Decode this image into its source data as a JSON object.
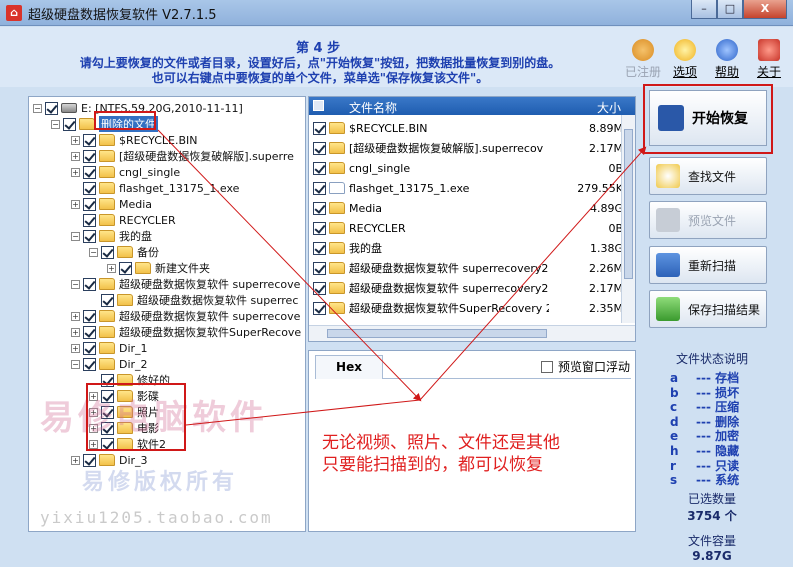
{
  "window": {
    "title": "超级硬盘数据恢复软件 V2.7.1.5",
    "buttons": {
      "minimize": "–",
      "maximize": "□",
      "close": "X"
    }
  },
  "header": {
    "step": "第 4 步",
    "line1": "请勾上要恢复的文件或者目录，设置好后，点\"开始恢复\"按钮，把数据批量恢复到别的盘。",
    "line2": "也可以右键点中要恢复的单个文件，菜单选\"保存恢复该文件\"。"
  },
  "topicons": [
    {
      "label": "已注册",
      "icon": "cart-icon",
      "disabled": true
    },
    {
      "label": "选项",
      "icon": "gear-icon",
      "disabled": false
    },
    {
      "label": "帮助",
      "icon": "help-icon",
      "disabled": false
    },
    {
      "label": "关于",
      "icon": "home-icon",
      "disabled": false
    }
  ],
  "tree": {
    "root": "E:  [NTFS,59.20G,2010-11-11]",
    "items": [
      {
        "label": "删除的文件",
        "selected": true
      },
      {
        "label": "$RECYCLE.BIN"
      },
      {
        "label": "[超级硬盘数据恢复破解版].superre"
      },
      {
        "label": "cngl_single"
      },
      {
        "label": "flashget_13175_1.exe"
      },
      {
        "label": "Media"
      },
      {
        "label": "RECYCLER"
      },
      {
        "label": "我的盘"
      },
      {
        "label": "备份"
      },
      {
        "label": "新建文件夹"
      },
      {
        "label": "超级硬盘数据恢复软件 superrecove"
      },
      {
        "label": "超级硬盘数据恢复软件 superrec"
      },
      {
        "label": "超级硬盘数据恢复软件 superrecove"
      },
      {
        "label": "超级硬盘数据恢复软件SuperRecove"
      },
      {
        "label": "Dir_1"
      },
      {
        "label": "Dir_2"
      },
      {
        "label": "修好的"
      },
      {
        "label": "影碟"
      },
      {
        "label": "照片"
      },
      {
        "label": "电影"
      },
      {
        "label": "软件2"
      },
      {
        "label": "Dir_3"
      }
    ]
  },
  "filelist": {
    "col_name": "文件名称",
    "col_size": "大小",
    "rows": [
      {
        "name": "$RECYCLE.BIN",
        "size": "8.89M"
      },
      {
        "name": "[超级硬盘数据恢复破解版].superrecov",
        "size": "2.17M"
      },
      {
        "name": "cngl_single",
        "size": "0B"
      },
      {
        "name": "flashget_13175_1.exe",
        "size": "279.55K"
      },
      {
        "name": "Media",
        "size": "4.89G"
      },
      {
        "name": "RECYCLER",
        "size": "0B"
      },
      {
        "name": "我的盘",
        "size": "1.38G"
      },
      {
        "name": "超级硬盘数据恢复软件 superrecovery2",
        "size": "2.26M"
      },
      {
        "name": "超级硬盘数据恢复软件 superrecovery2",
        "size": "2.17M"
      },
      {
        "name": "超级硬盘数据恢复软件SuperRecovery 2",
        "size": "2.35M"
      }
    ]
  },
  "preview": {
    "tab": "Hex",
    "float_label": "预览窗口浮动",
    "annotation_l1": "无论视频、照片、文件还是其他",
    "annotation_l2": "只要能扫描到的，都可以恢复"
  },
  "actions": {
    "start": "开始恢复",
    "find": "查找文件",
    "preview": "预览文件",
    "rescan": "重新扫描",
    "save": "保存扫描结果"
  },
  "legend": {
    "title": "文件状态说明",
    "items": [
      {
        "key": "a",
        "label": "存档"
      },
      {
        "key": "b",
        "label": "损坏"
      },
      {
        "key": "c",
        "label": "压缩"
      },
      {
        "key": "d",
        "label": "删除"
      },
      {
        "key": "e",
        "label": "加密"
      },
      {
        "key": "h",
        "label": "隐藏"
      },
      {
        "key": "r",
        "label": "只读"
      },
      {
        "key": "s",
        "label": "系统"
      }
    ],
    "selected_label": "已选数量",
    "selected_value": "3754 个",
    "capacity_label": "文件容量",
    "capacity_value": "9.87G"
  },
  "watermark": {
    "line1": "易修电脑软件",
    "line2": "易修版权所有",
    "line3": "yixiu1205.taobao.com"
  }
}
